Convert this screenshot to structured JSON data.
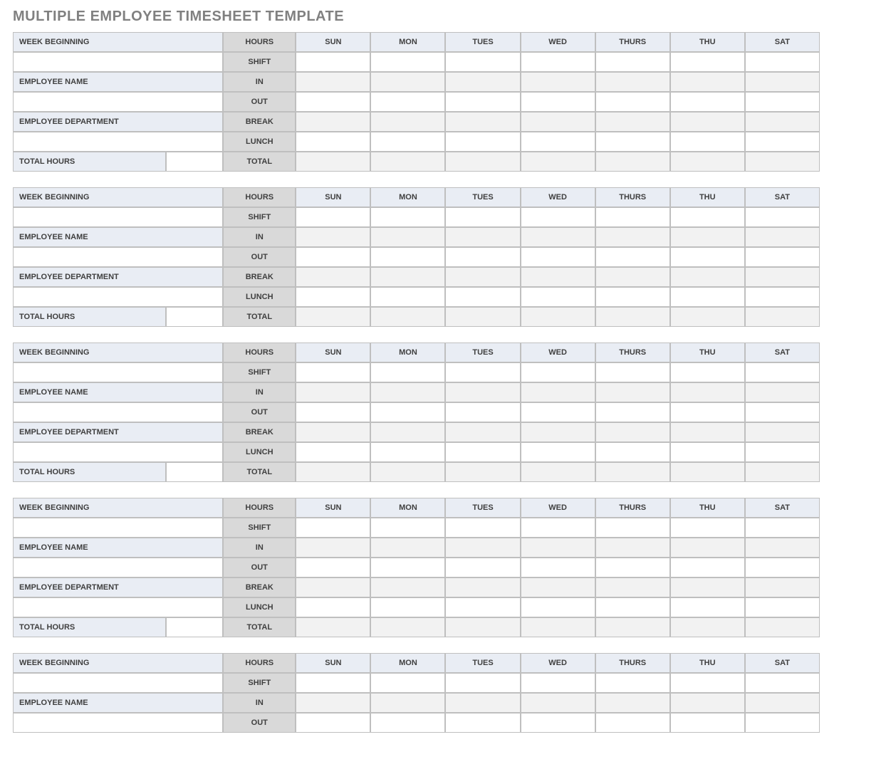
{
  "title": "MULTIPLE EMPLOYEE TIMESHEET TEMPLATE",
  "labels": {
    "week_beginning": "WEEK BEGINNING",
    "employee_name": "EMPLOYEE NAME",
    "employee_department": "EMPLOYEE DEPARTMENT",
    "total_hours": "TOTAL HOURS",
    "hours": "HOURS",
    "shift": "SHIFT",
    "in": "IN",
    "out": "OUT",
    "break": "BREAK",
    "lunch": "LUNCH",
    "total": "TOTAL"
  },
  "days": [
    "SUN",
    "MON",
    "TUES",
    "WED",
    "THURS",
    "THU",
    "SAT"
  ],
  "blocks": [
    {
      "week_beginning": "",
      "employee_name": "",
      "employee_department": "",
      "total_hours": "",
      "weekly": {
        "shift": [
          "",
          "",
          "",
          "",
          "",
          "",
          ""
        ],
        "in": [
          "",
          "",
          "",
          "",
          "",
          "",
          ""
        ],
        "out": [
          "",
          "",
          "",
          "",
          "",
          "",
          ""
        ],
        "break": [
          "",
          "",
          "",
          "",
          "",
          "",
          ""
        ],
        "lunch": [
          "",
          "",
          "",
          "",
          "",
          "",
          ""
        ],
        "total": [
          "",
          "",
          "",
          "",
          "",
          "",
          ""
        ]
      }
    },
    {
      "week_beginning": "",
      "employee_name": "",
      "employee_department": "",
      "total_hours": "",
      "weekly": {
        "shift": [
          "",
          "",
          "",
          "",
          "",
          "",
          ""
        ],
        "in": [
          "",
          "",
          "",
          "",
          "",
          "",
          ""
        ],
        "out": [
          "",
          "",
          "",
          "",
          "",
          "",
          ""
        ],
        "break": [
          "",
          "",
          "",
          "",
          "",
          "",
          ""
        ],
        "lunch": [
          "",
          "",
          "",
          "",
          "",
          "",
          ""
        ],
        "total": [
          "",
          "",
          "",
          "",
          "",
          "",
          ""
        ]
      }
    },
    {
      "week_beginning": "",
      "employee_name": "",
      "employee_department": "",
      "total_hours": "",
      "weekly": {
        "shift": [
          "",
          "",
          "",
          "",
          "",
          "",
          ""
        ],
        "in": [
          "",
          "",
          "",
          "",
          "",
          "",
          ""
        ],
        "out": [
          "",
          "",
          "",
          "",
          "",
          "",
          ""
        ],
        "break": [
          "",
          "",
          "",
          "",
          "",
          "",
          ""
        ],
        "lunch": [
          "",
          "",
          "",
          "",
          "",
          "",
          ""
        ],
        "total": [
          "",
          "",
          "",
          "",
          "",
          "",
          ""
        ]
      }
    },
    {
      "week_beginning": "",
      "employee_name": "",
      "employee_department": "",
      "total_hours": "",
      "weekly": {
        "shift": [
          "",
          "",
          "",
          "",
          "",
          "",
          ""
        ],
        "in": [
          "",
          "",
          "",
          "",
          "",
          "",
          ""
        ],
        "out": [
          "",
          "",
          "",
          "",
          "",
          "",
          ""
        ],
        "break": [
          "",
          "",
          "",
          "",
          "",
          "",
          ""
        ],
        "lunch": [
          "",
          "",
          "",
          "",
          "",
          "",
          ""
        ],
        "total": [
          "",
          "",
          "",
          "",
          "",
          "",
          ""
        ]
      }
    },
    {
      "week_beginning": "",
      "employee_name": "",
      "employee_department": "",
      "total_hours": "",
      "weekly": {
        "shift": [
          "",
          "",
          "",
          "",
          "",
          "",
          ""
        ],
        "in": [
          "",
          "",
          "",
          "",
          "",
          "",
          ""
        ],
        "out": [
          "",
          "",
          "",
          "",
          "",
          "",
          ""
        ],
        "break": [
          "",
          "",
          "",
          "",
          "",
          "",
          ""
        ],
        "lunch": [
          "",
          "",
          "",
          "",
          "",
          "",
          ""
        ],
        "total": [
          "",
          "",
          "",
          "",
          "",
          "",
          ""
        ]
      }
    }
  ],
  "visible_rows_last_block": 3
}
